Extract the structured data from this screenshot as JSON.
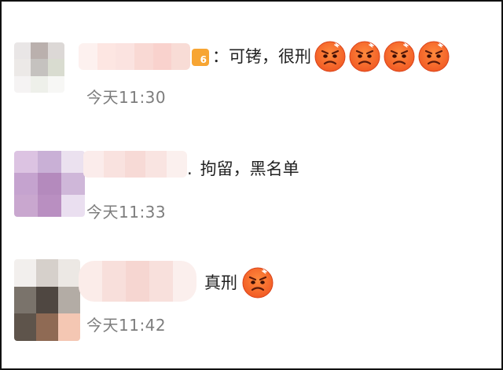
{
  "comments": [
    {
      "separator": "：",
      "text": "可铐，很刑",
      "time": "今天11:30",
      "emoji_count": 4,
      "emoji_icon": "angry-face-icon",
      "vip_badge": "6"
    },
    {
      "separator": ".",
      "text": "拘留，黑名单",
      "time": "今天11:33"
    },
    {
      "separator": "",
      "text": "真刑",
      "time": "今天11:42",
      "emoji_count": 1,
      "emoji_icon": "angry-face-icon"
    }
  ],
  "colors": {
    "text": "#222222",
    "time": "#7d7d7d",
    "emoji_face": "#f15a24",
    "vip_badge": "#f7a533"
  }
}
